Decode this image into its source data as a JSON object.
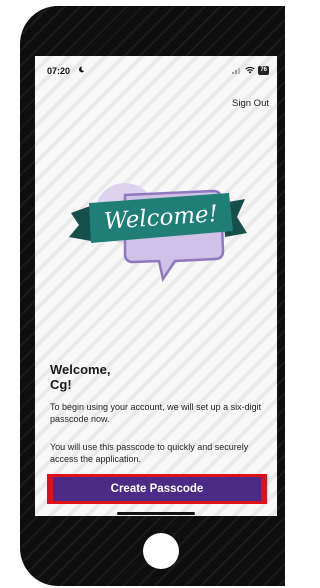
{
  "status_bar": {
    "time": "07:20",
    "battery": "76"
  },
  "header": {
    "sign_out_label": "Sign Out"
  },
  "illustration": {
    "banner_text": "Welcome!"
  },
  "main": {
    "heading_line1": "Welcome,",
    "heading_line2": "Cg!",
    "paragraph1": "To begin using your account, we will set up a six-digit passcode now.",
    "paragraph2": "You will use this passcode to quickly and securely access the application.",
    "cta_label": "Create Passcode"
  },
  "colors": {
    "primary": "#4b2b86",
    "banner_teal": "#1f7f77",
    "bubble_lavender": "#cfc1e8",
    "highlight_red": "#e0101a"
  }
}
